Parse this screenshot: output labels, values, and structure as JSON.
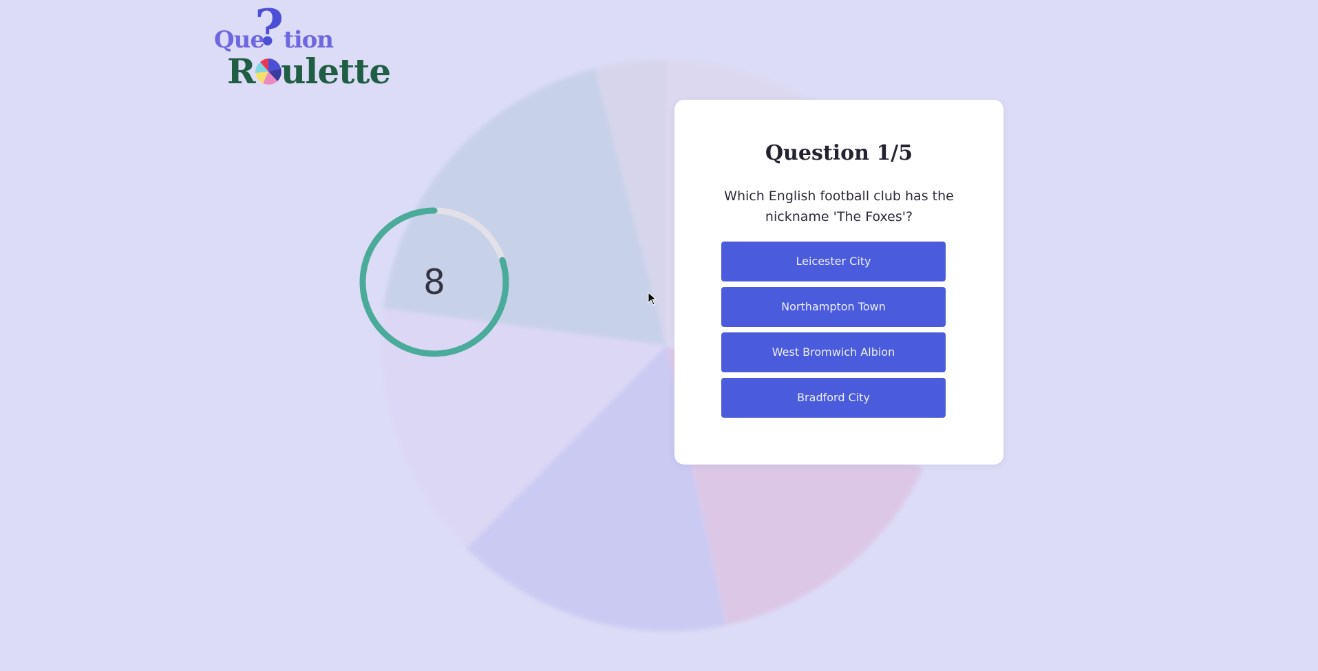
{
  "logo": {
    "alt": "Question Roulette"
  },
  "timer": {
    "seconds_left": "8",
    "fraction_remaining": 0.8,
    "ring_color": "#4aab9a",
    "track_color": "#e4e0ea"
  },
  "quiz": {
    "title": "Question 1/5",
    "question": "Which English football club has the nickname 'The Foxes'?",
    "answers": [
      {
        "label": "Leicester City"
      },
      {
        "label": "Northampton Town"
      },
      {
        "label": "West Bromwich Albion"
      },
      {
        "label": "Bradford City"
      }
    ]
  },
  "colors": {
    "background": "#dcdcf6",
    "button": "#4a5bdc",
    "card": "#ffffff",
    "logo_green": "#1f5e44",
    "logo_purple": "#6f67e0"
  },
  "icons": {
    "cursor": "mouse-pointer-icon",
    "wheel": "roulette-wheel-icon"
  }
}
